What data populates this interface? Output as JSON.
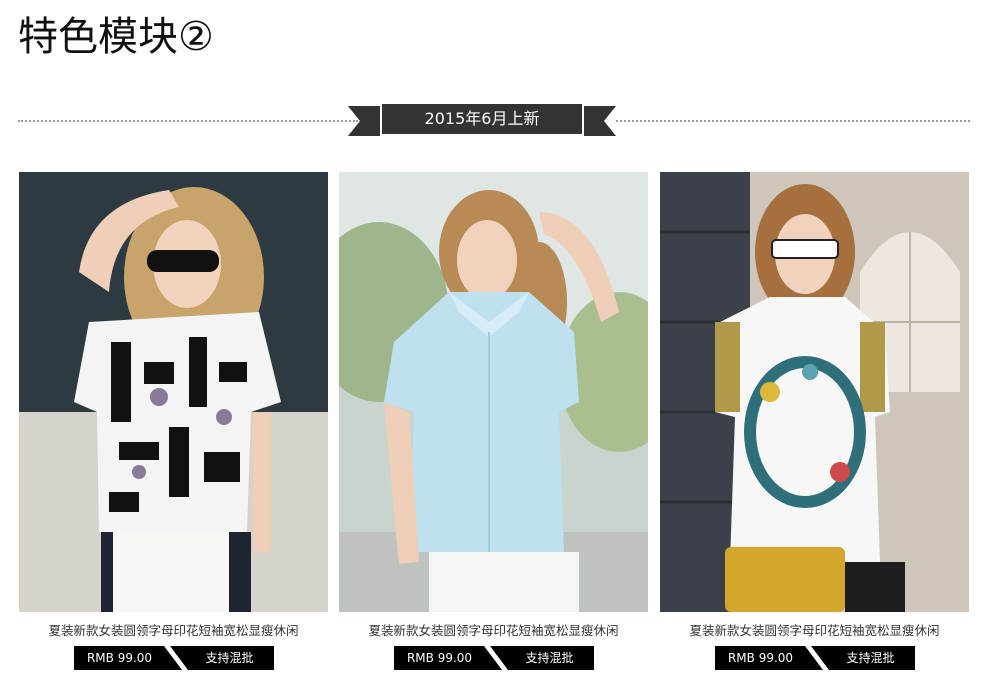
{
  "page": {
    "title": "特色模块②",
    "banner_label": "2015年6月上新"
  },
  "products": [
    {
      "name": "夏装新款女装圆领字母印花短袖宽松显瘦休闲",
      "price": "RMB 99.00",
      "tag": "支持混批"
    },
    {
      "name": "夏装新款女装圆领字母印花短袖宽松显瘦休闲",
      "price": "RMB 99.00",
      "tag": "支持混批"
    },
    {
      "name": "夏装新款女装圆领字母印花短袖宽松显瘦休闲",
      "price": "RMB 99.00",
      "tag": "支持混批"
    }
  ],
  "colors": {
    "banner_bg": "#333333",
    "price_bar_bg": "#000000",
    "text": "#333333"
  }
}
